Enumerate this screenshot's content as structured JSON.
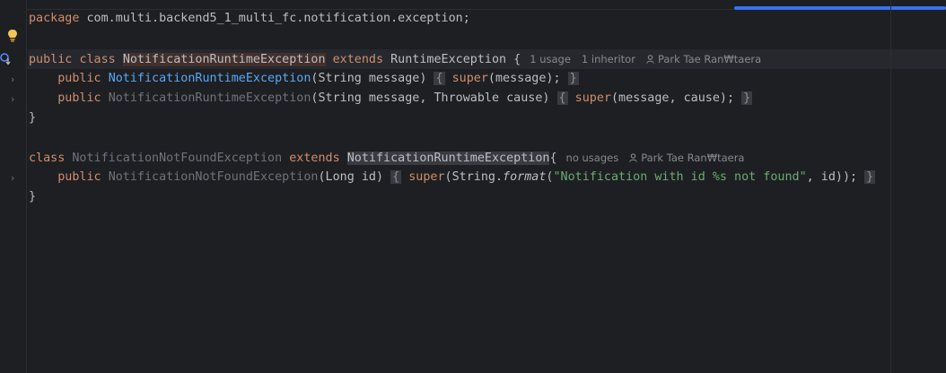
{
  "code": {
    "line1": {
      "kw": "package",
      "rest": " com.multi.backend5_1_multi_fc.notification.exception;"
    },
    "line3": {
      "kw1": "public",
      "kw2": "class",
      "name": "NotificationRuntimeException",
      "kw3": "extends",
      "parent": "RuntimeException",
      "brace": " {",
      "hint_usages": "1 usage",
      "hint_inheritors": "1 inheritor",
      "hint_author": "Park Tae Ran₩taera"
    },
    "line4": {
      "kw": "public",
      "ctor": "NotificationRuntimeException",
      "params": "(String message)",
      "open": "{",
      "sup": "super",
      "call": "(message);",
      "close": "}"
    },
    "line5": {
      "kw": "public",
      "ctor": "NotificationRuntimeException",
      "params": "(String message, Throwable cause)",
      "open": "{",
      "sup": "super",
      "call": "(message, cause);",
      "close": "}"
    },
    "line6": {
      "close": "}"
    },
    "line8": {
      "kw1": "class",
      "name": "NotificationNotFoundException",
      "kw2": "extends",
      "parent": "NotificationRuntimeException",
      "brace": "{",
      "hint_usages": "no usages",
      "hint_author": "Park Tae Ran₩taera"
    },
    "line9": {
      "kw": "public",
      "ctor": "NotificationNotFoundException",
      "params": "(Long id)",
      "open": "{",
      "sup": "super",
      "pre": "(String.",
      "method": "format",
      "paren": "(",
      "str": "\"Notification with id %s not found\"",
      "post": ", id));",
      "close": "}"
    },
    "line10": {
      "close": "}"
    }
  },
  "icons": [
    "lightbulb-icon",
    "implementations-icon",
    "chevron-right-icon",
    "user-icon"
  ],
  "colors": {
    "background": "#1e1f22",
    "keyword": "#cf8e6d",
    "string": "#6aab73",
    "function": "#56a8f5",
    "accent": "#3574f0"
  }
}
